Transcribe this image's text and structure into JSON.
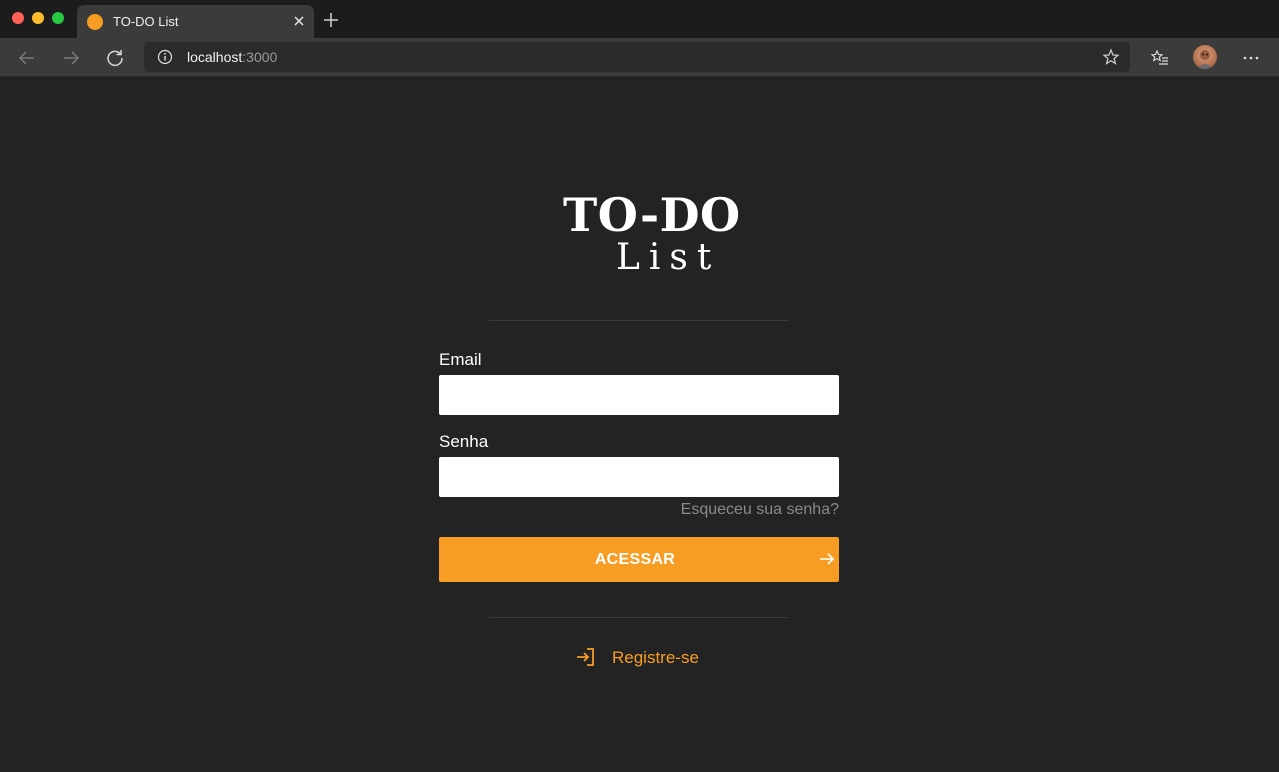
{
  "browser": {
    "tab_title": "TO-DO List",
    "url_host": "localhost",
    "url_port": ":3000"
  },
  "logo": {
    "line1": "TO-DO",
    "line2": "List"
  },
  "form": {
    "email_label": "Email",
    "email_value": "",
    "password_label": "Senha",
    "password_value": "",
    "forgot_link": "Esqueceu sua senha?",
    "submit_label": "ACESSAR",
    "register_link": "Registre-se"
  },
  "colors": {
    "accent": "#f89d23",
    "background": "#232323",
    "muted_text": "#8a8a8a"
  }
}
